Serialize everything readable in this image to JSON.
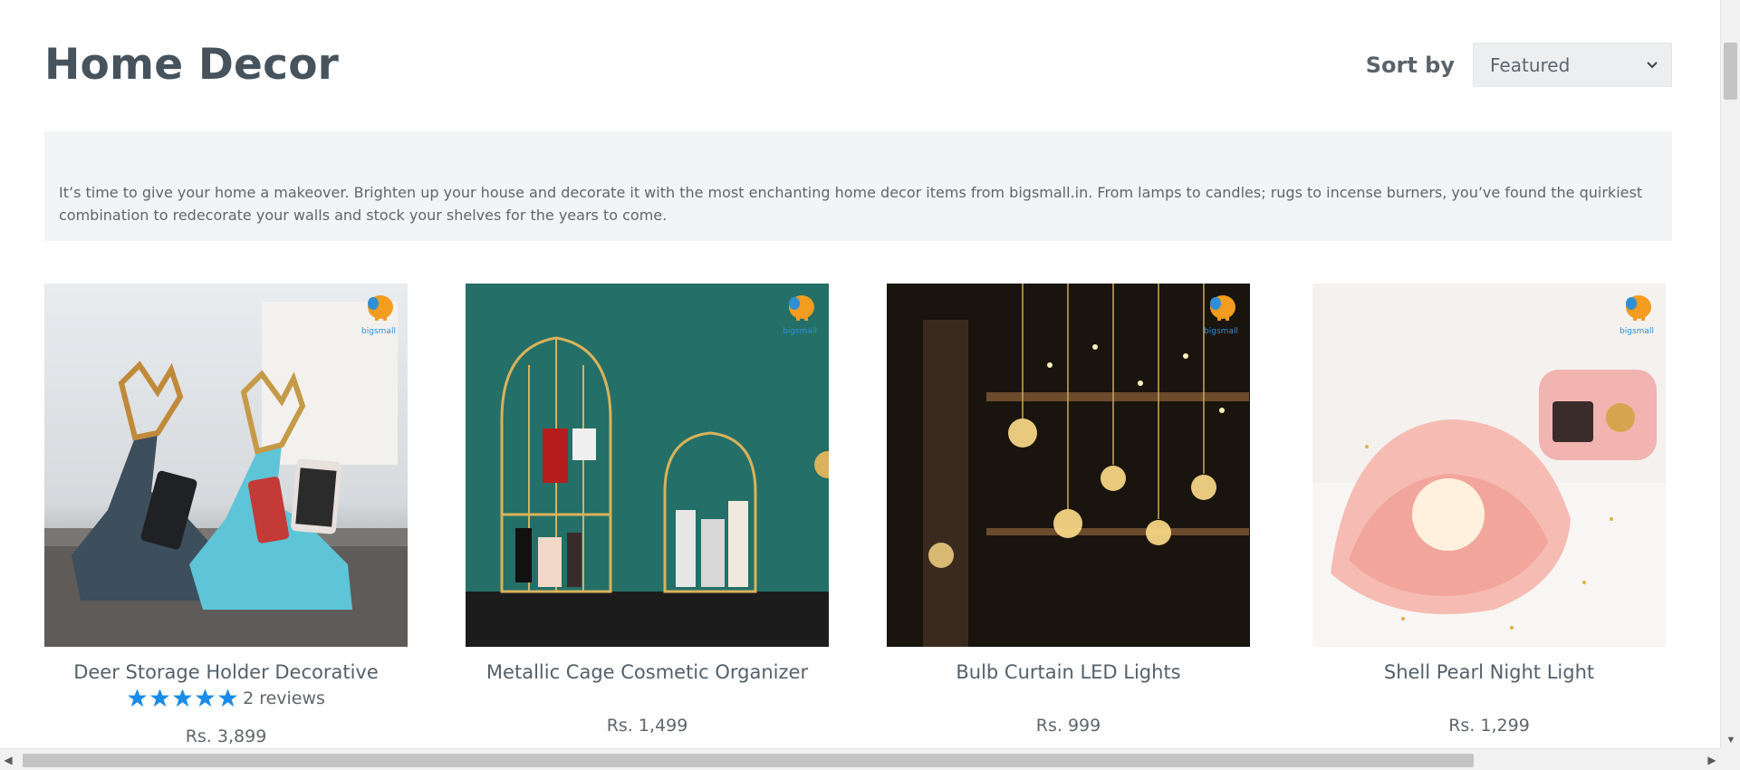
{
  "collection": {
    "title": "Home Decor",
    "sort_label": "Sort by",
    "sort_value": "Featured",
    "description": "It’s time to give your home a makeover. Brighten up your house and decorate it with the most enchanting home decor items from bigsmall.in. From lamps to candles; rugs to incense burners, you’ve found the quirkiest combination to redecorate your walls and stock your shelves for the years to come."
  },
  "products": [
    {
      "title": "Deer Storage Holder Decorative",
      "rating_stars": 5,
      "reviews_text": "2 reviews",
      "price": "Rs. 3,899",
      "image_icon": "deer-holder-image"
    },
    {
      "title": "Metallic Cage Cosmetic Organizer",
      "price": "Rs. 1,499",
      "image_icon": "cage-organizer-image"
    },
    {
      "title": "Bulb Curtain LED Lights",
      "price": "Rs. 999",
      "image_icon": "led-lights-image"
    },
    {
      "title": "Shell Pearl Night Light",
      "price": "Rs. 1,299",
      "image_icon": "shell-light-image"
    }
  ],
  "brand_logo_text": "bigsmall.in",
  "colors": {
    "star": "#1a8ce8",
    "title": "#46535d",
    "description_bg": "#f3f4f5",
    "select_bg": "#eceef0"
  }
}
